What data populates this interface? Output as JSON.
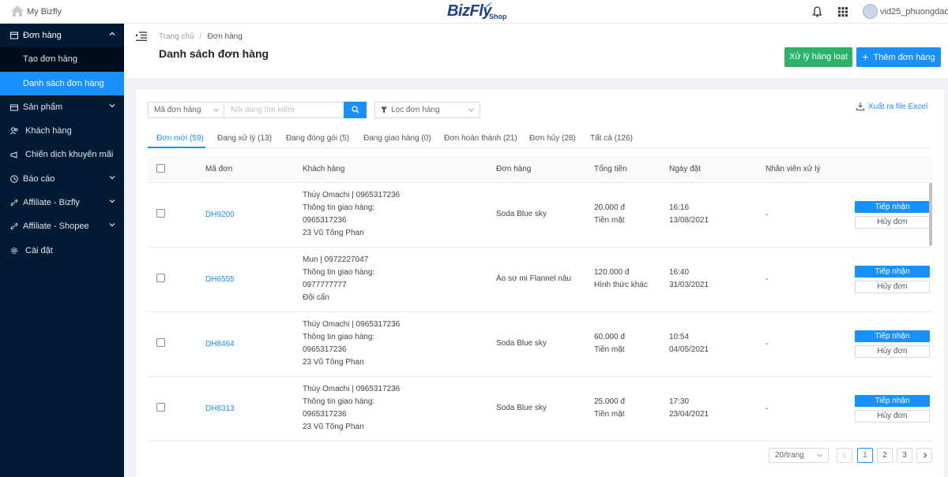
{
  "topbar": {
    "app_name": "My Bizfly",
    "brand_main": "BizFly",
    "brand_sub": "Shop",
    "username": "vid25_phuongdaohuy"
  },
  "sidebar": {
    "items": [
      {
        "label": "Đơn hàng",
        "icon": "orders-icon"
      },
      {
        "label": "Tạo đơn hàng"
      },
      {
        "label": "Danh sách đơn hàng"
      },
      {
        "label": "Sản phẩm",
        "icon": "box-icon"
      },
      {
        "label": "Khách hàng",
        "icon": "users-icon"
      },
      {
        "label": "Chiến dịch khuyến mãi",
        "icon": "megaphone-icon"
      },
      {
        "label": "Báo cáo",
        "icon": "report-icon"
      },
      {
        "label": "Affiliate - Bizfly",
        "icon": "link-icon"
      },
      {
        "label": "Affiliate - Shopee",
        "icon": "link-icon"
      },
      {
        "label": "Cài đặt",
        "icon": "gear-icon"
      }
    ]
  },
  "header": {
    "breadcrumb_home": "Trang chủ",
    "breadcrumb_sep": "/",
    "breadcrumb_current": "Đơn hàng",
    "title": "Danh sách đơn hàng",
    "bulk_button": "Xử lý hàng loạt",
    "add_button": "Thêm đơn hàng"
  },
  "filters": {
    "search_field": "Mã đơn hàng",
    "search_placeholder": "Nội dung tìm kiếm",
    "filter_label": "Lọc đơn hàng",
    "export_label": "Xuất ra file Excel"
  },
  "tabs": [
    {
      "label": "Đơn mới (59)",
      "active": true
    },
    {
      "label": "Đang xử lý (13)"
    },
    {
      "label": "Đang đóng gói (5)"
    },
    {
      "label": "Đang giao hàng (0)"
    },
    {
      "label": "Đơn hoàn thành (21)"
    },
    {
      "label": "Đơn hủy (28)"
    },
    {
      "label": "Tất cả (126)"
    }
  ],
  "table": {
    "columns": [
      "Mã đơn",
      "Khách hàng",
      "Đơn hàng",
      "Tổng tiền",
      "Ngày đặt",
      "Nhân viên xử lý"
    ],
    "rows": [
      {
        "code": "DH9200",
        "customer": "Thùy Omachi | 0965317236",
        "ship_label": "Thông tin giao hàng:",
        "ship_phone": "0965317236",
        "ship_address": "23 Vũ Tông Phan",
        "product": "Soda Blue sky",
        "total": "20.000 đ",
        "payment": "Tiền mặt",
        "time": "16:16",
        "date": "13/08/2021",
        "staff": "-",
        "accept": "Tiếp nhận",
        "cancel": "Hủy đơn"
      },
      {
        "code": "DH6555",
        "customer": "Mun | 0972227047",
        "ship_label": "Thông tin giao hàng:",
        "ship_phone": "0977777777",
        "ship_address": "Đội cấn",
        "product": "Áo sơ mi Flannel nâu",
        "total": "120.000 đ",
        "payment": "Hình thức khác",
        "time": "16:40",
        "date": "31/03/2021",
        "staff": "-",
        "accept": "Tiếp nhận",
        "cancel": "Hủy đơn"
      },
      {
        "code": "DH8464",
        "customer": "Thùy Omachi | 0965317236",
        "ship_label": "Thông tin giao hàng:",
        "ship_phone": "0965317236",
        "ship_address": "23 Vũ Tông Phan",
        "product": "Soda Blue sky",
        "total": "60.000 đ",
        "payment": "Tiền mặt",
        "time": "10:54",
        "date": "04/05/2021",
        "staff": "-",
        "accept": "Tiếp nhận",
        "cancel": "Hủy đơn"
      },
      {
        "code": "DH8313",
        "customer": "Thùy Omachi | 0965317236",
        "ship_label": "Thông tin giao hàng:",
        "ship_phone": "0965317236",
        "ship_address": "23 Vũ Tông Phan",
        "product": "Soda Blue sky",
        "total": "25.000 đ",
        "payment": "Tiền mặt",
        "time": "17:30",
        "date": "23/04/2021",
        "staff": "-",
        "accept": "Tiếp nhận",
        "cancel": "Hủy đơn"
      }
    ]
  },
  "pagination": {
    "page_size": "20/trang",
    "pages": [
      "1",
      "2",
      "3"
    ],
    "current": "1"
  },
  "colors": {
    "primary": "#1890ff",
    "success": "#2bb36a",
    "sidebar_bg": "#021a33"
  }
}
